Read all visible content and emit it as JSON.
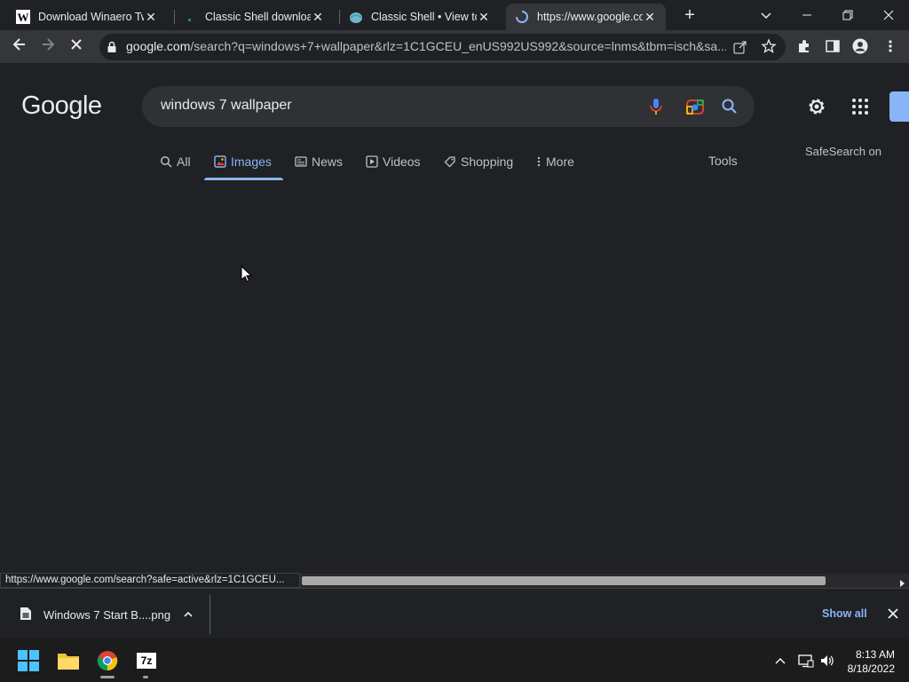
{
  "tabs": [
    {
      "title": "Download Winaero Tweaker",
      "favicon": "winaero-w-icon"
    },
    {
      "title": "Classic Shell downloads",
      "favicon": "classic-shell-small-icon"
    },
    {
      "title": "Classic Shell • View topic",
      "favicon": "classic-shell-shell-icon"
    },
    {
      "title": "https://www.google.com/search",
      "favicon": "loading-spinner-icon",
      "active": true
    }
  ],
  "new_tab_label": "+",
  "address": {
    "host": "google.com",
    "path": "/search?q=windows+7+wallpaper&rlz=1C1GCEU_enUS992US992&source=lnms&tbm=isch&sa..."
  },
  "google": {
    "logo": "Google",
    "query": "windows 7 wallpaper",
    "nav": [
      "All",
      "Images",
      "News",
      "Videos",
      "Shopping",
      "More"
    ],
    "selected_nav": "Images",
    "tools": "Tools",
    "safesearch": "SafeSearch on"
  },
  "status_url": "https://www.google.com/search?safe=active&rlz=1C1GCEU...",
  "download": {
    "filename": "Windows 7 Start B....png",
    "show_all": "Show all"
  },
  "taskbar": {
    "time": "8:13 AM",
    "date": "8/18/2022",
    "seven_zip_label": "7z"
  },
  "colors": {
    "accent": "#8ab4f8",
    "page_bg": "#202124",
    "toolbar_bg": "#35363a"
  }
}
